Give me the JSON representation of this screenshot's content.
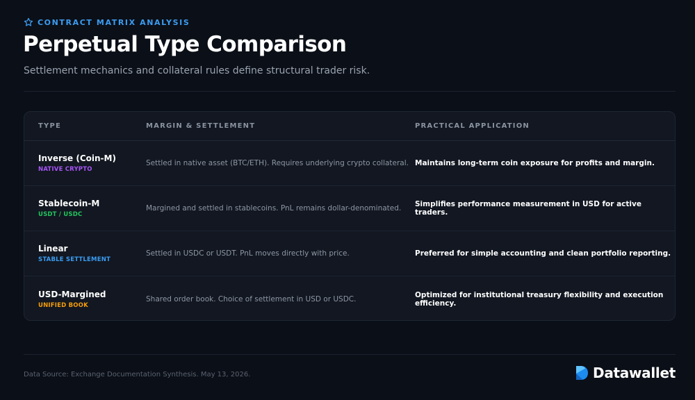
{
  "header": {
    "eyebrow": "CONTRACT MATRIX ANALYSIS",
    "eyebrow_icon": "star-icon",
    "title": "Perpetual Type Comparison",
    "subtitle": "Settlement mechanics and collateral rules define structural trader risk."
  },
  "table": {
    "columns": [
      "TYPE",
      "MARGIN & SETTLEMENT",
      "PRACTICAL APPLICATION"
    ],
    "rows": [
      {
        "type": "Inverse (Coin-M)",
        "tag": "NATIVE CRYPTO",
        "tag_color": "#a855f7",
        "margin": "Settled in native asset (BTC/ETH). Requires underlying crypto collateral.",
        "application": "Maintains long-term coin exposure for profits and margin."
      },
      {
        "type": "Stablecoin-M",
        "tag": "USDT / USDC",
        "tag_color": "#22c55e",
        "margin": "Margined and settled in stablecoins. PnL remains dollar-denominated.",
        "application": "Simplifies performance measurement in USD for active traders."
      },
      {
        "type": "Linear",
        "tag": "STABLE SETTLEMENT",
        "tag_color": "#3b9cf2",
        "margin": "Settled in USDC or USDT. PnL moves directly with price.",
        "application": "Preferred for simple accounting and clean portfolio reporting."
      },
      {
        "type": "USD-Margined",
        "tag": "UNIFIED BOOK",
        "tag_color": "#f59e0b",
        "margin": "Shared order book. Choice of settlement in USD or USDC.",
        "application": "Optimized for institutional treasury flexibility and execution efficiency."
      }
    ]
  },
  "footer": {
    "source": "Data Source: Exchange Documentation Synthesis. May 13, 2026.",
    "brand": "Datawallet",
    "brand_icon": "datawallet-logo-icon"
  },
  "colors": {
    "accent": "#3b9cf2",
    "background": "#0b0f17",
    "card": "#121721"
  }
}
